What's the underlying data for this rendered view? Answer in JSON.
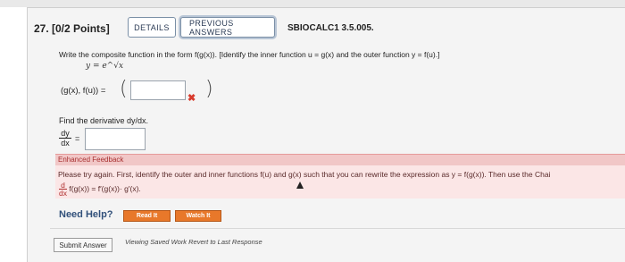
{
  "question": {
    "number": "27. [0/2 Points]",
    "tabs": [
      "DETAILS",
      "PREVIOUS ANSWERS"
    ],
    "course": "SBIOCALC1 3.5.005.",
    "instruction": "Write the composite function in the form f(g(x)). [Identify the inner function u = g(x) and the outer function y = f(u).]",
    "equation": "y = e^√x",
    "pair_label": "(g(x), f(u)) =",
    "pair_open": "(",
    "pair_close": ")",
    "wrong_mark": "✖",
    "find_derivative": "Find the derivative dy/dx.",
    "dy": "dy",
    "dx": "dx",
    "equals": "="
  },
  "feedback": {
    "title": "Enhanced Feedback",
    "text": "Please try again. First, identify the outer and inner functions f(u) and g(x) such that you can rewrite the expression as y = f(g(x)). Then use the Chai",
    "d": "d",
    "dx": "dx",
    "formula": "f(g(x)) = f′(g(x))· g′(x)."
  },
  "help": {
    "label": "Need Help?",
    "read": "Read It",
    "watch": "Watch It"
  },
  "footer": {
    "submit": "Submit Answer",
    "viewing": "Viewing Saved Work Revert to Last Response"
  }
}
